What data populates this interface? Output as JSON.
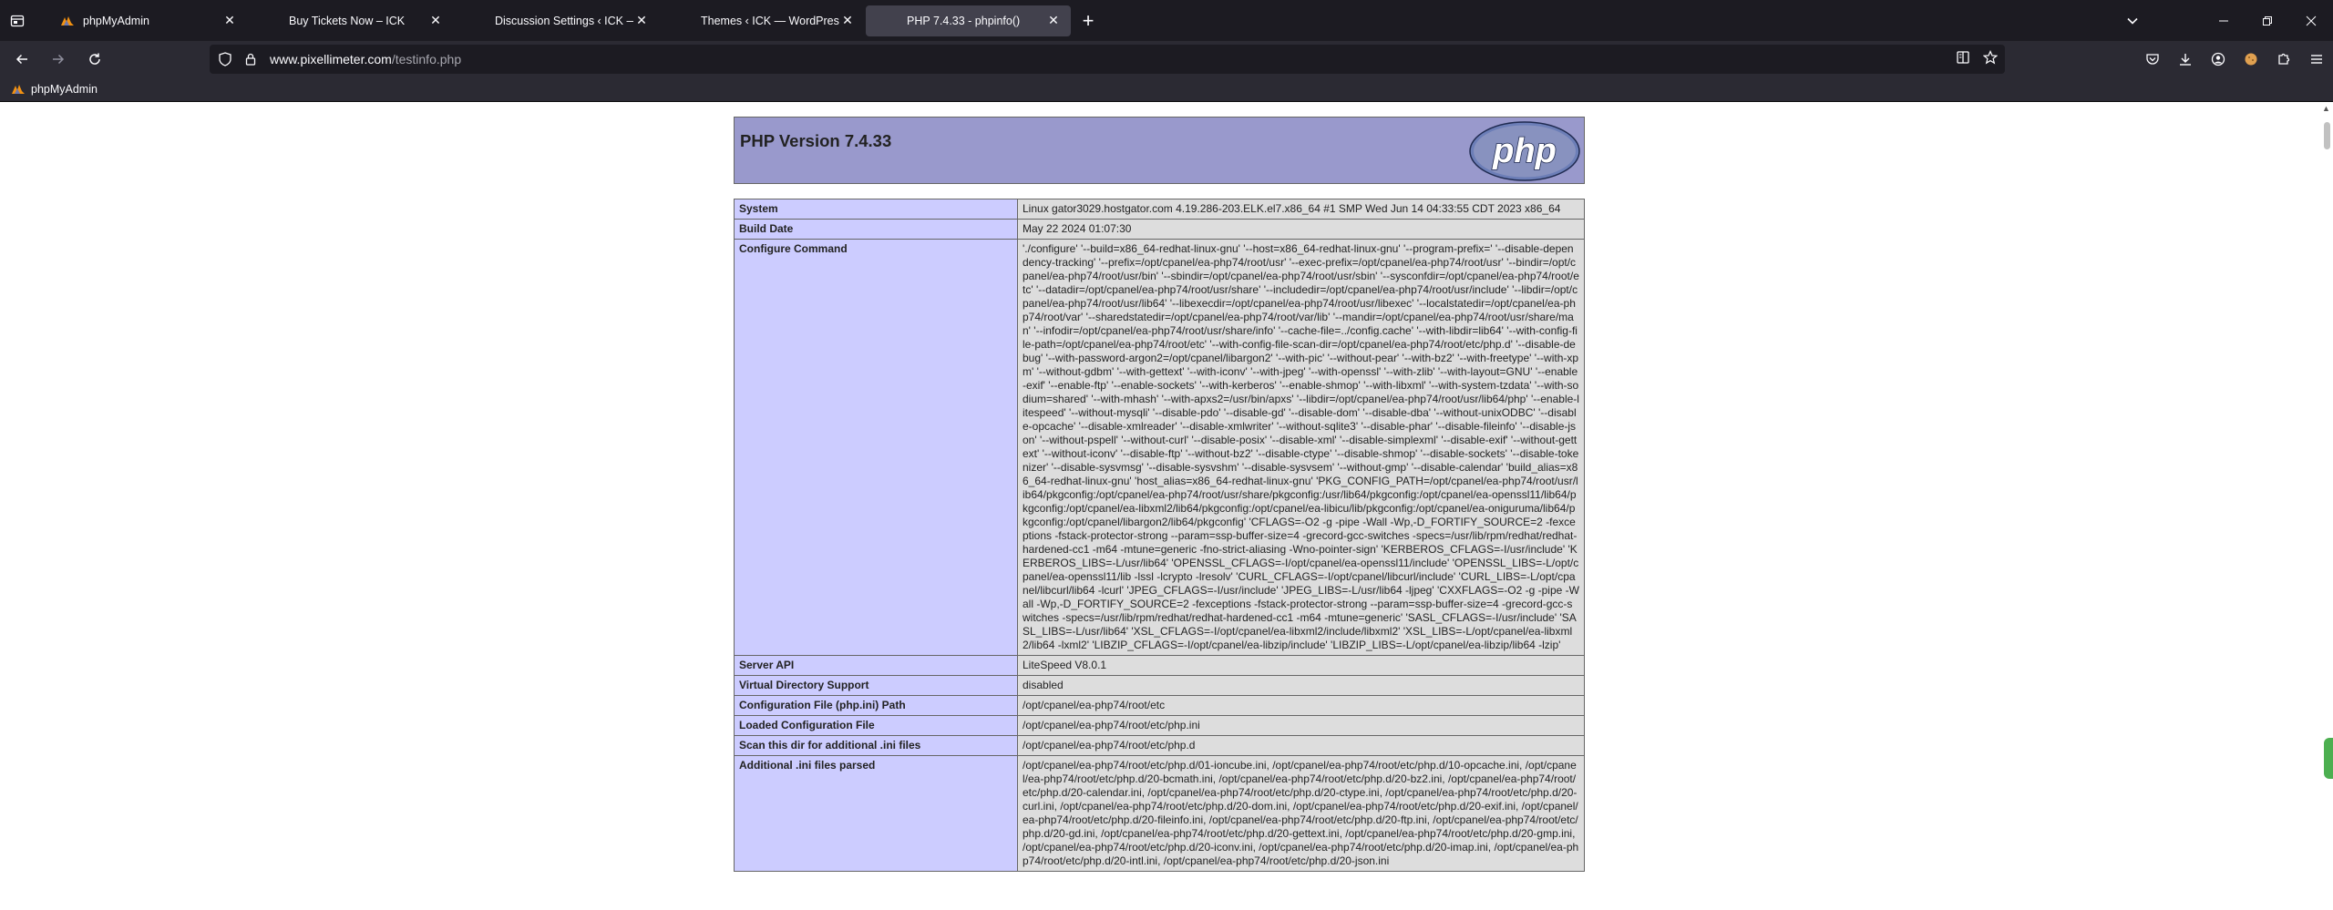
{
  "browser": {
    "tabs": [
      {
        "label": "phpMyAdmin",
        "favicon": "phpmyadmin-icon",
        "active": false
      },
      {
        "label": "Buy Tickets Now – ICK",
        "favicon": "none",
        "active": false
      },
      {
        "label": "Discussion Settings ‹ ICK — WordPr",
        "favicon": "none",
        "active": false
      },
      {
        "label": "Themes ‹ ICK — WordPress",
        "favicon": "none",
        "active": false
      },
      {
        "label": "PHP 7.4.33 - phpinfo()",
        "favicon": "none",
        "active": true
      }
    ],
    "url_domain": "www.pixellimeter.com",
    "url_path": "/testinfo.php",
    "bookmarks": [
      {
        "label": "phpMyAdmin",
        "favicon": "phpmyadmin-icon"
      }
    ]
  },
  "phpinfo": {
    "title": "PHP Version 7.4.33",
    "logo_text": "php",
    "rows": [
      {
        "key": "System",
        "value": "Linux gator3029.hostgator.com 4.19.286-203.ELK.el7.x86_64 #1 SMP Wed Jun 14 04:33:55 CDT 2023 x86_64"
      },
      {
        "key": "Build Date",
        "value": "May 22 2024 01:07:30"
      },
      {
        "key": "Configure Command",
        "value": "'./configure' '--build=x86_64-redhat-linux-gnu' '--host=x86_64-redhat-linux-gnu' '--program-prefix=' '--disable-dependency-tracking' '--prefix=/opt/cpanel/ea-php74/root/usr' '--exec-prefix=/opt/cpanel/ea-php74/root/usr' '--bindir=/opt/cpanel/ea-php74/root/usr/bin' '--sbindir=/opt/cpanel/ea-php74/root/usr/sbin' '--sysconfdir=/opt/cpanel/ea-php74/root/etc' '--datadir=/opt/cpanel/ea-php74/root/usr/share' '--includedir=/opt/cpanel/ea-php74/root/usr/include' '--libdir=/opt/cpanel/ea-php74/root/usr/lib64' '--libexecdir=/opt/cpanel/ea-php74/root/usr/libexec' '--localstatedir=/opt/cpanel/ea-php74/root/var' '--sharedstatedir=/opt/cpanel/ea-php74/root/var/lib' '--mandir=/opt/cpanel/ea-php74/root/usr/share/man' '--infodir=/opt/cpanel/ea-php74/root/usr/share/info' '--cache-file=../config.cache' '--with-libdir=lib64' '--with-config-file-path=/opt/cpanel/ea-php74/root/etc' '--with-config-file-scan-dir=/opt/cpanel/ea-php74/root/etc/php.d' '--disable-debug' '--with-password-argon2=/opt/cpanel/libargon2' '--with-pic' '--without-pear' '--with-bz2' '--with-freetype' '--with-xpm' '--without-gdbm' '--with-gettext' '--with-iconv' '--with-jpeg' '--with-openssl' '--with-zlib' '--with-layout=GNU' '--enable-exif' '--enable-ftp' '--enable-sockets' '--with-kerberos' '--enable-shmop' '--with-libxml' '--with-system-tzdata' '--with-sodium=shared' '--with-mhash' '--with-apxs2=/usr/bin/apxs' '--libdir=/opt/cpanel/ea-php74/root/usr/lib64/php' '--enable-litespeed' '--without-mysqli' '--disable-pdo' '--disable-gd' '--disable-dom' '--disable-dba' '--without-unixODBC' '--disable-opcache' '--disable-xmlreader' '--disable-xmlwriter' '--without-sqlite3' '--disable-phar' '--disable-fileinfo' '--disable-json' '--without-pspell' '--without-curl' '--disable-posix' '--disable-xml' '--disable-simplexml' '--disable-exif' '--without-gettext' '--without-iconv' '--disable-ftp' '--without-bz2' '--disable-ctype' '--disable-shmop' '--disable-sockets' '--disable-tokenizer' '--disable-sysvmsg' '--disable-sysvshm' '--disable-sysvsem' '--without-gmp' '--disable-calendar' 'build_alias=x86_64-redhat-linux-gnu' 'host_alias=x86_64-redhat-linux-gnu' 'PKG_CONFIG_PATH=/opt/cpanel/ea-php74/root/usr/lib64/pkgconfig:/opt/cpanel/ea-php74/root/usr/share/pkgconfig:/usr/lib64/pkgconfig:/opt/cpanel/ea-openssl11/lib64/pkgconfig:/opt/cpanel/ea-libxml2/lib64/pkgconfig:/opt/cpanel/ea-libicu/lib/pkgconfig:/opt/cpanel/ea-oniguruma/lib64/pkgconfig:/opt/cpanel/libargon2/lib64/pkgconfig' 'CFLAGS=-O2 -g -pipe -Wall -Wp,-D_FORTIFY_SOURCE=2 -fexceptions -fstack-protector-strong --param=ssp-buffer-size=4 -grecord-gcc-switches -specs=/usr/lib/rpm/redhat/redhat-hardened-cc1 -m64 -mtune=generic -fno-strict-aliasing -Wno-pointer-sign' 'KERBEROS_CFLAGS=-I/usr/include' 'KERBEROS_LIBS=-L/usr/lib64' 'OPENSSL_CFLAGS=-I/opt/cpanel/ea-openssl11/include' 'OPENSSL_LIBS=-L/opt/cpanel/ea-openssl11/lib -lssl -lcrypto -lresolv' 'CURL_CFLAGS=-I/opt/cpanel/libcurl/include' 'CURL_LIBS=-L/opt/cpanel/libcurl/lib64 -lcurl' 'JPEG_CFLAGS=-I/usr/include' 'JPEG_LIBS=-L/usr/lib64 -ljpeg' 'CXXFLAGS=-O2 -g -pipe -Wall -Wp,-D_FORTIFY_SOURCE=2 -fexceptions -fstack-protector-strong --param=ssp-buffer-size=4 -grecord-gcc-switches -specs=/usr/lib/rpm/redhat/redhat-hardened-cc1 -m64 -mtune=generic' 'SASL_CFLAGS=-I/usr/include' 'SASL_LIBS=-L/usr/lib64' 'XSL_CFLAGS=-I/opt/cpanel/ea-libxml2/include/libxml2' 'XSL_LIBS=-L/opt/cpanel/ea-libxml2/lib64 -lxml2' 'LIBZIP_CFLAGS=-I/opt/cpanel/ea-libzip/include' 'LIBZIP_LIBS=-L/opt/cpanel/ea-libzip/lib64 -lzip'"
      },
      {
        "key": "Server API",
        "value": "LiteSpeed V8.0.1"
      },
      {
        "key": "Virtual Directory Support",
        "value": "disabled"
      },
      {
        "key": "Configuration File (php.ini) Path",
        "value": "/opt/cpanel/ea-php74/root/etc"
      },
      {
        "key": "Loaded Configuration File",
        "value": "/opt/cpanel/ea-php74/root/etc/php.ini"
      },
      {
        "key": "Scan this dir for additional .ini files",
        "value": "/opt/cpanel/ea-php74/root/etc/php.d"
      },
      {
        "key": "Additional .ini files parsed",
        "value": "/opt/cpanel/ea-php74/root/etc/php.d/01-ioncube.ini, /opt/cpanel/ea-php74/root/etc/php.d/10-opcache.ini, /opt/cpanel/ea-php74/root/etc/php.d/20-bcmath.ini, /opt/cpanel/ea-php74/root/etc/php.d/20-bz2.ini, /opt/cpanel/ea-php74/root/etc/php.d/20-calendar.ini, /opt/cpanel/ea-php74/root/etc/php.d/20-ctype.ini, /opt/cpanel/ea-php74/root/etc/php.d/20-curl.ini, /opt/cpanel/ea-php74/root/etc/php.d/20-dom.ini, /opt/cpanel/ea-php74/root/etc/php.d/20-exif.ini, /opt/cpanel/ea-php74/root/etc/php.d/20-fileinfo.ini, /opt/cpanel/ea-php74/root/etc/php.d/20-ftp.ini, /opt/cpanel/ea-php74/root/etc/php.d/20-gd.ini, /opt/cpanel/ea-php74/root/etc/php.d/20-gettext.ini, /opt/cpanel/ea-php74/root/etc/php.d/20-gmp.ini, /opt/cpanel/ea-php74/root/etc/php.d/20-iconv.ini, /opt/cpanel/ea-php74/root/etc/php.d/20-imap.ini, /opt/cpanel/ea-php74/root/etc/php.d/20-intl.ini, /opt/cpanel/ea-php74/root/etc/php.d/20-json.ini"
      }
    ]
  }
}
